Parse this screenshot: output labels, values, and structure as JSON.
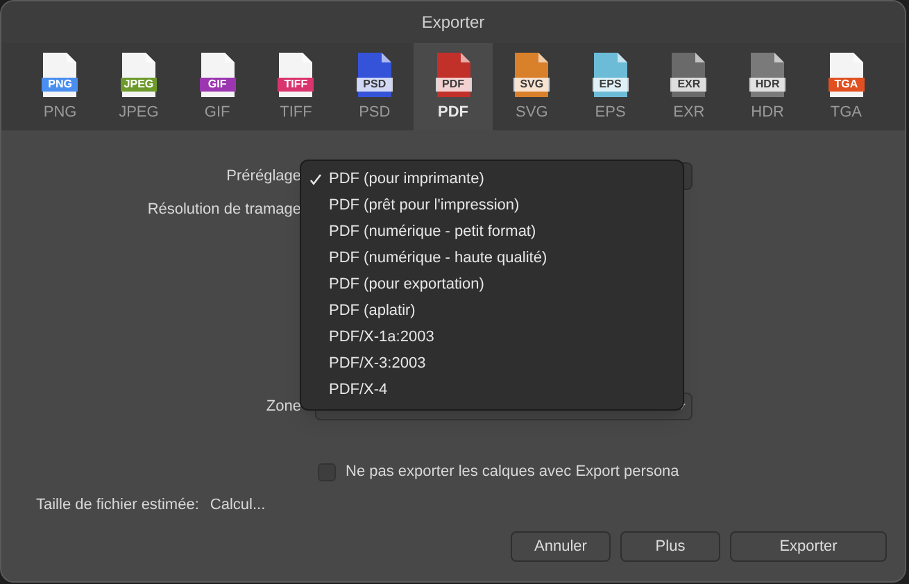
{
  "window": {
    "title": "Exporter"
  },
  "formats": [
    {
      "label": "PNG",
      "badge": "PNG",
      "kind": "plain",
      "color": "#4a8ff0",
      "selected": false
    },
    {
      "label": "JPEG",
      "badge": "JPEG",
      "kind": "plain",
      "color": "#6e9a2c",
      "selected": false
    },
    {
      "label": "GIF",
      "badge": "GIF",
      "kind": "plain",
      "color": "#9b36b0",
      "selected": false
    },
    {
      "label": "TIFF",
      "badge": "TIFF",
      "kind": "plain",
      "color": "#d9346e",
      "selected": false
    },
    {
      "label": "PSD",
      "badge": "PSD",
      "kind": "filled",
      "color": "#3553d8",
      "selected": false
    },
    {
      "label": "PDF",
      "badge": "PDF",
      "kind": "filled",
      "color": "#c2302a",
      "selected": true
    },
    {
      "label": "SVG",
      "badge": "SVG",
      "kind": "filled",
      "color": "#d9802a",
      "selected": false
    },
    {
      "label": "EPS",
      "badge": "EPS",
      "kind": "filled",
      "color": "#6cbcd8",
      "selected": false
    },
    {
      "label": "EXR",
      "badge": "EXR",
      "kind": "filled",
      "color": "#6a6a6a",
      "selected": false
    },
    {
      "label": "HDR",
      "badge": "HDR",
      "kind": "filled",
      "color": "#7a7a7a",
      "selected": false
    },
    {
      "label": "TGA",
      "badge": "TGA",
      "kind": "plain",
      "color": "#e05020",
      "selected": false
    }
  ],
  "fields": {
    "preset_label": "Préréglage",
    "raster_label": "Résolution de tramage",
    "zone_label": "Zone"
  },
  "preset_menu": [
    {
      "label": "PDF (pour imprimante)",
      "selected": true
    },
    {
      "label": "PDF (prêt pour l'impression)",
      "selected": false
    },
    {
      "label": "PDF (numérique - petit format)",
      "selected": false
    },
    {
      "label": "PDF (numérique - haute qualité)",
      "selected": false
    },
    {
      "label": "PDF (pour exportation)",
      "selected": false
    },
    {
      "label": "PDF (aplatir)",
      "selected": false
    },
    {
      "label": "PDF/X-1a:2003",
      "selected": false
    },
    {
      "label": "PDF/X-3:2003",
      "selected": false
    },
    {
      "label": "PDF/X-4",
      "selected": false
    }
  ],
  "layers_option": {
    "label": "Ne pas exporter les calques avec Export persona",
    "checked": false
  },
  "file_size": {
    "label": "Taille de fichier estimée:",
    "value": "Calcul..."
  },
  "buttons": [
    "Annuler",
    "Plus",
    "Exporter"
  ]
}
